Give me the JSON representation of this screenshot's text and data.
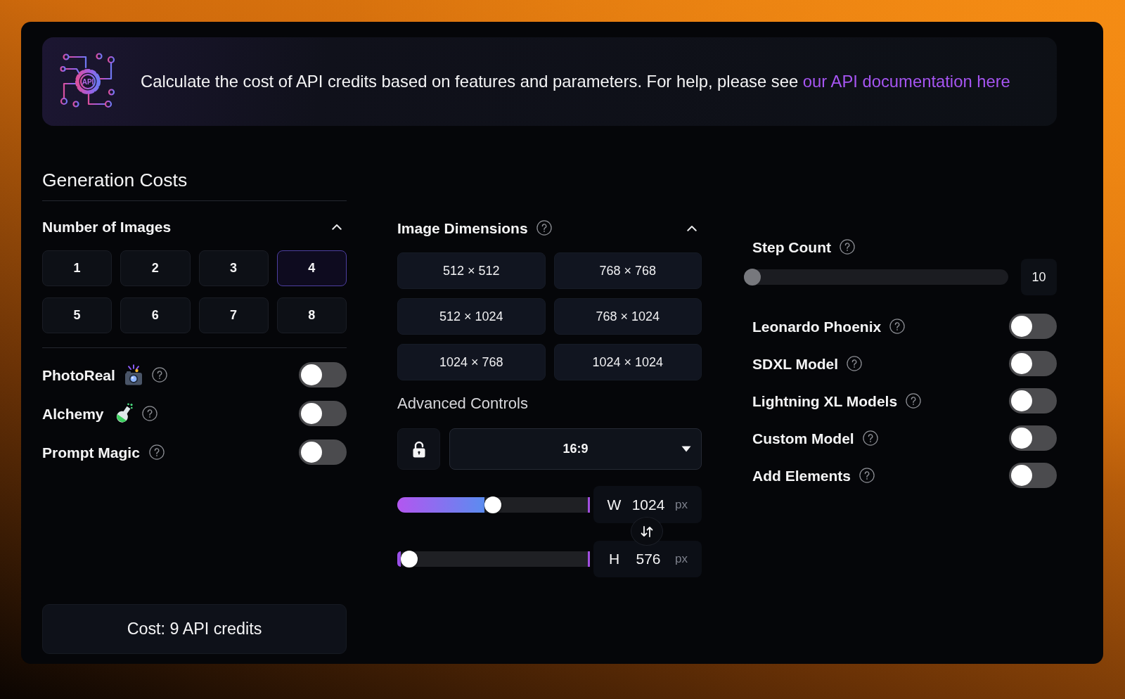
{
  "banner": {
    "logo_text": "API",
    "description": "Calculate the cost of API credits based on features and parameters. For help, please see ",
    "link": "our API documentation here"
  },
  "generation_costs": {
    "title": "Generation Costs",
    "number_of_images": {
      "title": "Number of Images",
      "expanded": true,
      "options": [
        {
          "label": "1",
          "selected": false
        },
        {
          "label": "2",
          "selected": false
        },
        {
          "label": "3",
          "selected": false
        },
        {
          "label": "4",
          "selected": true
        },
        {
          "label": "5",
          "selected": false
        },
        {
          "label": "6",
          "selected": false
        },
        {
          "label": "7",
          "selected": false
        },
        {
          "label": "8",
          "selected": false
        }
      ]
    },
    "features": [
      {
        "label": "PhotoReal",
        "on": false
      },
      {
        "label": "Alchemy",
        "on": false
      },
      {
        "label": "Prompt Magic",
        "on": false
      }
    ],
    "cost": "Cost: 9 API credits"
  },
  "image_dimensions": {
    "title": "Image Dimensions",
    "help": true,
    "expanded": true,
    "presets": [
      {
        "label": "512 × 512",
        "selected": false
      },
      {
        "label": "768 × 768",
        "selected": false
      },
      {
        "label": "512 × 1024",
        "selected": false
      },
      {
        "label": "768 × 1024",
        "selected": false
      },
      {
        "label": "1024 × 768",
        "selected": false
      },
      {
        "label": "1024 × 1024",
        "selected": false
      }
    ],
    "advanced_controls": {
      "title": "Advanced Controls",
      "aspect_lock": {
        "locked": false
      },
      "aspect_ratio": {
        "value": "16:9"
      },
      "width": {
        "label": "W",
        "value": "1024",
        "unit": "px",
        "level": 0.5
      },
      "height": {
        "label": "H",
        "value": "576",
        "unit": "px",
        "level": 0.02
      }
    }
  },
  "model_options": {
    "step_count": {
      "label": "Step Count",
      "level": 0,
      "value": "10"
    },
    "toggles": [
      {
        "label": "Leonardo Phoenix",
        "on": false
      },
      {
        "label": "SDXL Model",
        "on": false
      },
      {
        "label": "Lightning XL Models",
        "on": false
      },
      {
        "label": "Custom Model",
        "on": false
      },
      {
        "label": "Add Elements",
        "on": false
      }
    ]
  }
}
